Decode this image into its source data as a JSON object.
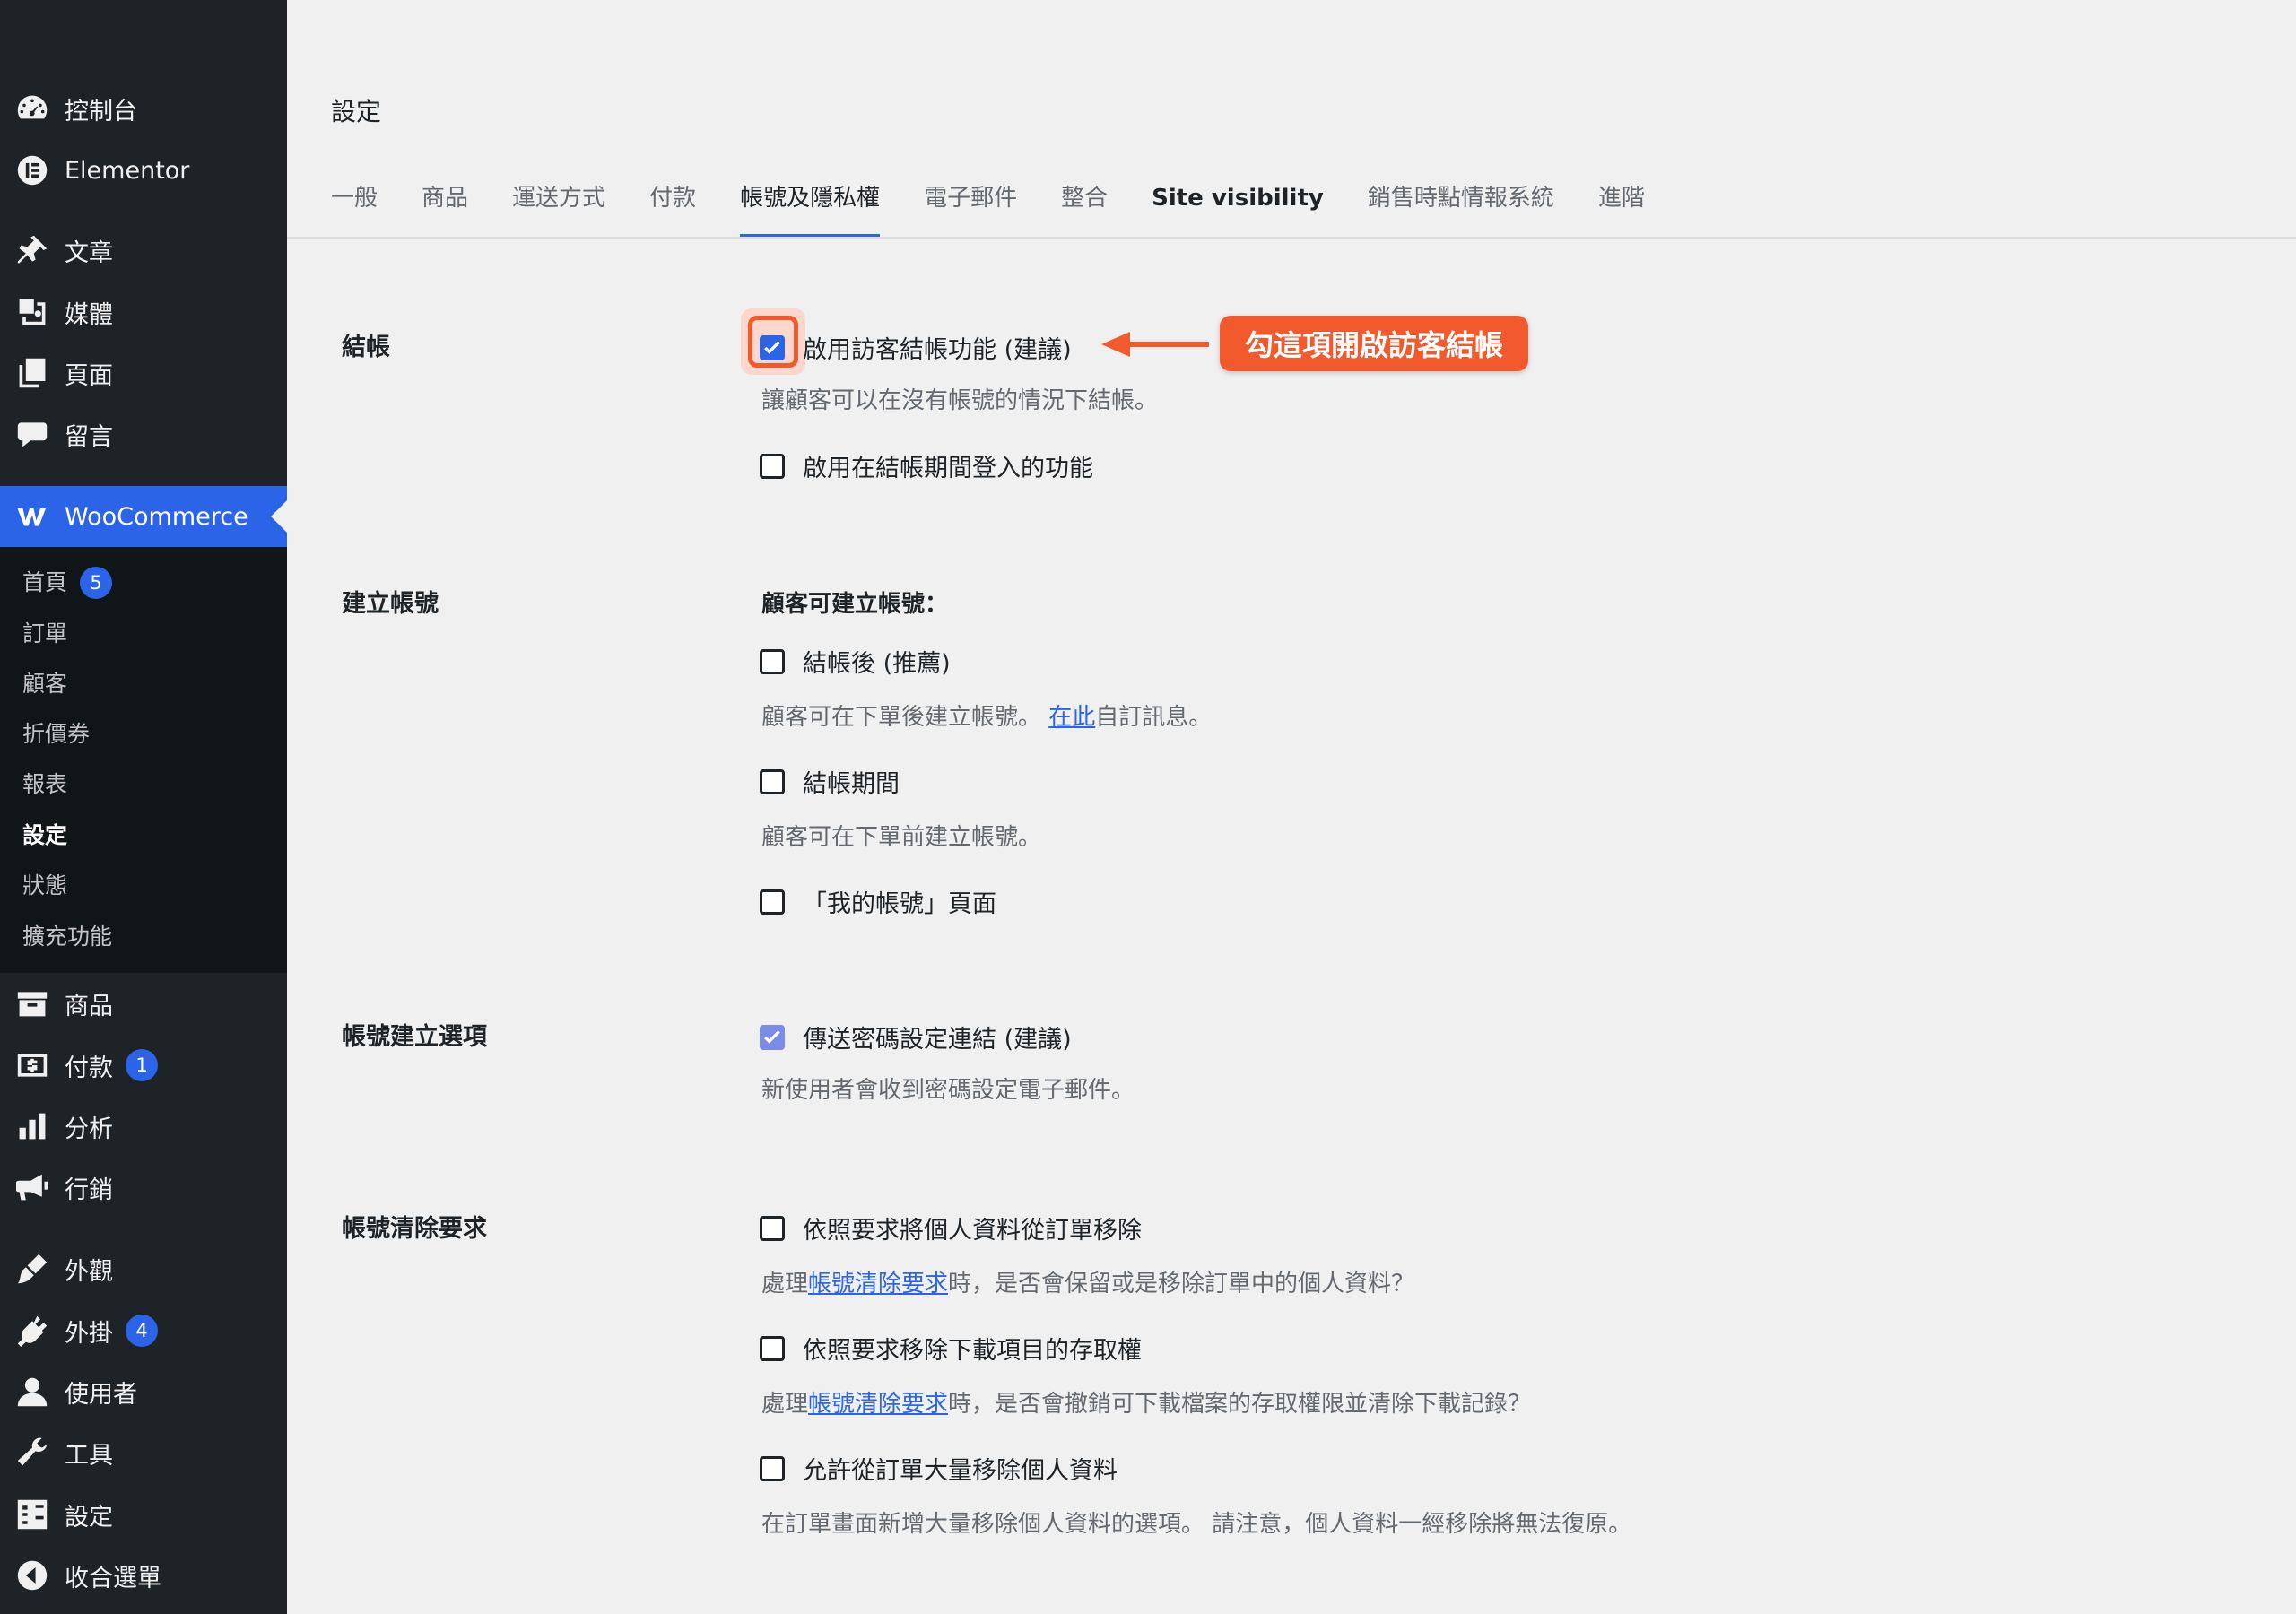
{
  "sidebar": {
    "top_items": [
      {
        "label": "控制台",
        "icon": "dashboard-icon"
      },
      {
        "label": "Elementor",
        "icon": "elementor-icon"
      },
      {
        "label": "文章",
        "icon": "pin-icon"
      },
      {
        "label": "媒體",
        "icon": "media-icon"
      },
      {
        "label": "頁面",
        "icon": "pages-icon"
      },
      {
        "label": "留言",
        "icon": "comment-icon"
      }
    ],
    "woocommerce": {
      "label": "WooCommerce",
      "icon": "woo-icon"
    },
    "submenu": [
      {
        "label": "首頁",
        "badge": "5"
      },
      {
        "label": "訂單"
      },
      {
        "label": "顧客"
      },
      {
        "label": "折價券"
      },
      {
        "label": "報表"
      },
      {
        "label": "設定"
      },
      {
        "label": "狀態"
      },
      {
        "label": "擴充功能"
      }
    ],
    "bottom_items": [
      {
        "label": "商品",
        "icon": "archive-icon"
      },
      {
        "label": "付款",
        "icon": "payment-icon",
        "badge": "1"
      },
      {
        "label": "分析",
        "icon": "chart-icon"
      },
      {
        "label": "行銷",
        "icon": "megaphone-icon"
      },
      {
        "label": "外觀",
        "icon": "brush-icon"
      },
      {
        "label": "外掛",
        "icon": "plugin-icon",
        "badge": "4"
      },
      {
        "label": "使用者",
        "icon": "user-icon"
      },
      {
        "label": "工具",
        "icon": "wrench-icon"
      },
      {
        "label": "設定",
        "icon": "settings-icon"
      },
      {
        "label": "收合選單",
        "icon": "collapse-icon"
      }
    ]
  },
  "page": {
    "title": "設定",
    "tabs": [
      "一般",
      "商品",
      "運送方式",
      "付款",
      "帳號及隱私權",
      "電子郵件",
      "整合",
      "Site visibility",
      "銷售時點情報系統",
      "進階"
    ],
    "active_tab": "帳號及隱私權"
  },
  "sections": {
    "checkout": {
      "label": "結帳",
      "guest_checkout": {
        "label": "啟用訪客結帳功能 (建議)",
        "checked": true,
        "desc": "讓顧客可以在沒有帳號的情況下結帳。"
      },
      "login_during_checkout": {
        "label": "啟用在結帳期間登入的功能",
        "checked": false
      }
    },
    "account_creation": {
      "label": "建立帳號",
      "heading": "顧客可建立帳號：",
      "after_checkout": {
        "label": "結帳後 (推薦)",
        "checked": false,
        "desc_prefix": "顧客可在下單後建立帳號。 ",
        "desc_link": "在此",
        "desc_suffix": "自訂訊息。"
      },
      "during_checkout": {
        "label": "結帳期間",
        "checked": false,
        "desc": "顧客可在下單前建立帳號。"
      },
      "my_account": {
        "label": "「我的帳號」頁面",
        "checked": false
      }
    },
    "account_options": {
      "label": "帳號建立選項",
      "send_password_link": {
        "label": "傳送密碼設定連結 (建議)",
        "checked": true,
        "desc": "新使用者會收到密碼設定電子郵件。"
      }
    },
    "erasure": {
      "label": "帳號清除要求",
      "remove_order_data": {
        "label": "依照要求將個人資料從訂單移除",
        "checked": false,
        "desc_prefix": "處理",
        "desc_link": "帳號清除要求",
        "desc_suffix": "時，是否會保留或是移除訂單中的個人資料？"
      },
      "remove_downloads": {
        "label": "依照要求移除下載項目的存取權",
        "checked": false,
        "desc_prefix": "處理",
        "desc_link": "帳號清除要求",
        "desc_suffix": "時，是否會撤銷可下載檔案的存取權限並清除下載記錄？"
      },
      "bulk_remove": {
        "label": "允許從訂單大量移除個人資料",
        "checked": false,
        "desc": "在訂單畫面新增大量移除個人資料的選項。 請注意，個人資料一經移除將無法復原。"
      }
    }
  },
  "annotation": {
    "callout_text": "勾這項開啟訪客結帳",
    "color": "#f25a2e"
  },
  "colors": {
    "sidebar_bg": "#1d2327",
    "accent": "#2c64e8",
    "submenu_bg": "#101517"
  }
}
